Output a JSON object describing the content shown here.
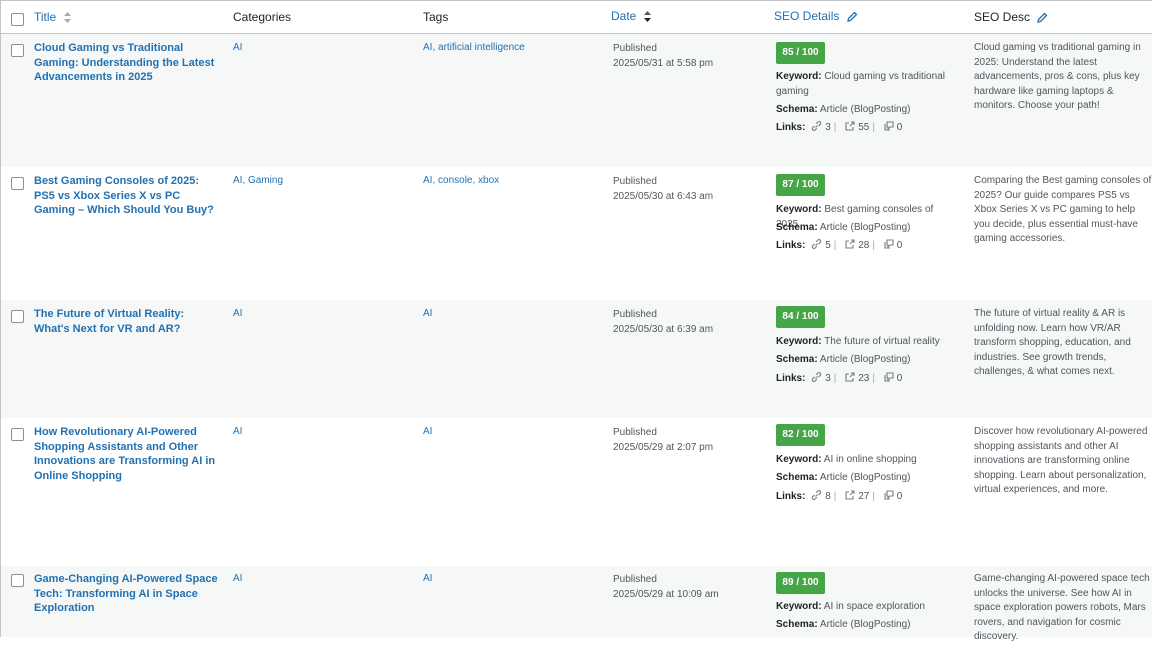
{
  "header": {
    "title": "Title",
    "categories": "Categories",
    "tags": "Tags",
    "date": "Date",
    "seo_details": "SEO Details",
    "seo_desc": "SEO Desc"
  },
  "labels": {
    "keyword": "Keyword:",
    "schema": "Schema:",
    "links": "Links:"
  },
  "rows": [
    {
      "title": "Cloud Gaming vs Traditional Gaming: Understanding the Latest Advancements in 2025",
      "categories": "AI",
      "tags": "AI, artificial intelligence",
      "status": "Published",
      "date": "2025/05/31 at 5:58 pm",
      "score": "85 / 100",
      "keyword": "Cloud gaming vs traditional gaming",
      "schema": "Article (BlogPosting)",
      "internal_links": "3",
      "external_links": "55",
      "incoming_links": "0",
      "desc": "Cloud gaming vs traditional gaming in 2025: Understand the latest advancements, pros & cons, plus key hardware like gaming laptops & monitors. Choose your path!"
    },
    {
      "title": "Best Gaming Consoles of 2025: PS5 vs Xbox Series X vs PC Gaming – Which Should You Buy?",
      "categories": "AI, Gaming",
      "tags": "AI, console, xbox",
      "status": "Published",
      "date": "2025/05/30 at 6:43 am",
      "score": "87 / 100",
      "keyword": "Best gaming consoles of 2025",
      "schema": "Article (BlogPosting)",
      "internal_links": "5",
      "external_links": "28",
      "incoming_links": "0",
      "desc": "Comparing the Best gaming consoles of 2025? Our guide compares PS5 vs Xbox Series X vs PC gaming to help you decide, plus essential must-have gaming accessories."
    },
    {
      "title": "The Future of Virtual Reality: What's Next for VR and AR?",
      "categories": "AI",
      "tags": "AI",
      "status": "Published",
      "date": "2025/05/30 at 6:39 am",
      "score": "84 / 100",
      "keyword": "The future of virtual reality",
      "schema": "Article (BlogPosting)",
      "internal_links": "3",
      "external_links": "23",
      "incoming_links": "0",
      "desc": "The future of virtual reality & AR is unfolding now. Learn how VR/AR transform shopping, education, and industries. See growth trends, challenges, & what comes next."
    },
    {
      "title": "How Revolutionary AI-Powered Shopping Assistants and Other Innovations are Transforming AI in Online Shopping",
      "categories": "AI",
      "tags": "AI",
      "status": "Published",
      "date": "2025/05/29 at 2:07 pm",
      "score": "82 / 100",
      "keyword": "AI in online shopping",
      "schema": "Article (BlogPosting)",
      "internal_links": "8",
      "external_links": "27",
      "incoming_links": "0",
      "desc": "Discover how revolutionary AI-powered shopping assistants and other AI innovations are transforming online shopping. Learn about personalization, virtual experiences, and more."
    },
    {
      "title": "Game-Changing AI-Powered Space Tech: Transforming AI in Space Exploration",
      "categories": "AI",
      "tags": "AI",
      "status": "Published",
      "date": "2025/05/29 at 10:09 am",
      "score": "89 / 100",
      "keyword": "AI in space exploration",
      "schema": "Article (BlogPosting)",
      "internal_links": "",
      "external_links": "",
      "incoming_links": "",
      "desc": "Game-changing AI-powered space tech unlocks the universe. See how AI in space exploration powers robots, Mars rovers, and navigation for cosmic discovery."
    }
  ],
  "colors": {
    "link": "#2271b1",
    "score_green": "#46a547",
    "alt_row": "#f6f7f7"
  }
}
